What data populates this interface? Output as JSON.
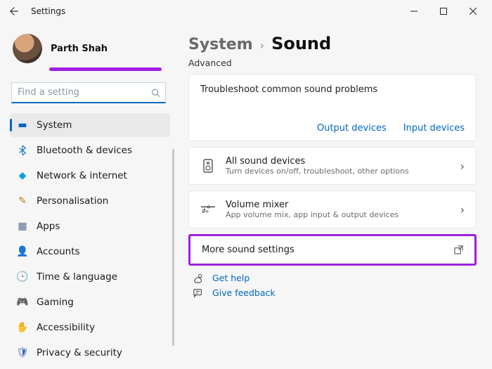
{
  "titlebar": {
    "title": "Settings"
  },
  "profile": {
    "name": "Parth Shah"
  },
  "search": {
    "placeholder": "Find a setting"
  },
  "sidebar": {
    "items": [
      {
        "label": "System",
        "icon": "display-icon",
        "active": true
      },
      {
        "label": "Bluetooth & devices",
        "icon": "bluetooth-icon"
      },
      {
        "label": "Network & internet",
        "icon": "wifi-icon"
      },
      {
        "label": "Personalisation",
        "icon": "brush-icon"
      },
      {
        "label": "Apps",
        "icon": "apps-icon"
      },
      {
        "label": "Accounts",
        "icon": "person-icon"
      },
      {
        "label": "Time & language",
        "icon": "clock-icon"
      },
      {
        "label": "Gaming",
        "icon": "gamepad-icon"
      },
      {
        "label": "Accessibility",
        "icon": "accessibility-icon"
      },
      {
        "label": "Privacy & security",
        "icon": "shield-icon"
      }
    ]
  },
  "breadcrumb": {
    "parent": "System",
    "current": "Sound"
  },
  "section": "Advanced",
  "troubleshoot": {
    "title": "Troubleshoot common sound problems",
    "output": "Output devices",
    "input": "Input devices"
  },
  "rows": {
    "allDevices": {
      "title": "All sound devices",
      "sub": "Turn devices on/off, troubleshoot, other options"
    },
    "mixer": {
      "title": "Volume mixer",
      "sub": "App volume mix, app input & output devices"
    },
    "more": {
      "title": "More sound settings"
    }
  },
  "footer": {
    "help": "Get help",
    "feedback": "Give feedback"
  },
  "colors": {
    "accent": "#0067c0",
    "highlight": "#a020e0"
  }
}
